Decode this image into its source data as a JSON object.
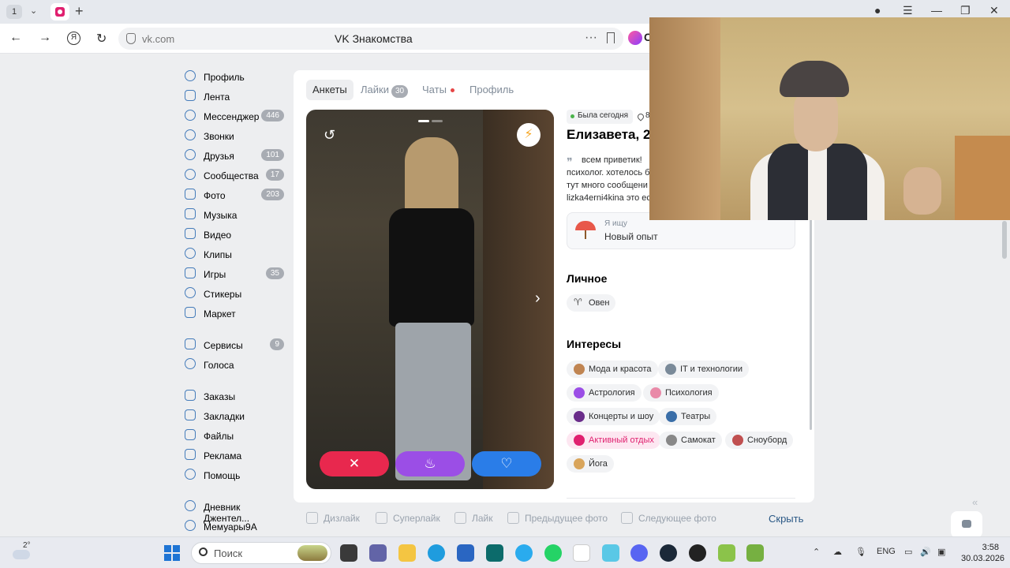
{
  "browser": {
    "tab_count": "1",
    "url": "vk.com",
    "page_title": "VK Знакомства",
    "alice_letter": "С"
  },
  "nav": [
    {
      "label": "Профиль",
      "badge": "",
      "icon": "profile-icon"
    },
    {
      "label": "Лента",
      "badge": "",
      "icon": "feed-icon"
    },
    {
      "label": "Мессенджер",
      "badge": "446",
      "icon": "messenger-icon"
    },
    {
      "label": "Звонки",
      "badge": "",
      "icon": "phone-icon"
    },
    {
      "label": "Друзья",
      "badge": "101",
      "icon": "friends-icon"
    },
    {
      "label": "Сообщества",
      "badge": "17",
      "icon": "communities-icon"
    },
    {
      "label": "Фото",
      "badge": "203",
      "icon": "photo-icon"
    },
    {
      "label": "Музыка",
      "badge": "",
      "icon": "music-icon"
    },
    {
      "label": "Видео",
      "badge": "",
      "icon": "video-icon"
    },
    {
      "label": "Клипы",
      "badge": "",
      "icon": "clips-icon"
    },
    {
      "label": "Игры",
      "badge": "35",
      "icon": "games-icon"
    },
    {
      "label": "Стикеры",
      "badge": "",
      "icon": "stickers-icon"
    },
    {
      "label": "Маркет",
      "badge": "",
      "icon": "market-icon"
    },
    {
      "label": "Сервисы",
      "badge": "9",
      "icon": "services-icon"
    },
    {
      "label": "Голоса",
      "badge": "",
      "icon": "votes-icon"
    },
    {
      "label": "Заказы",
      "badge": "",
      "icon": "orders-icon"
    },
    {
      "label": "Закладки",
      "badge": "",
      "icon": "bookmarks-icon"
    },
    {
      "label": "Файлы",
      "badge": "",
      "icon": "files-icon"
    },
    {
      "label": "Реклама",
      "badge": "",
      "icon": "ads-icon"
    },
    {
      "label": "Помощь",
      "badge": "",
      "icon": "help-icon"
    },
    {
      "label": "Дневник Джентел...",
      "badge": "",
      "icon": "group-icon"
    },
    {
      "label": "Мемуары9А",
      "badge": "",
      "icon": "group-icon"
    }
  ],
  "tabs": {
    "profiles": "Анкеты",
    "likes": "Лайки",
    "likes_count": "30",
    "chats": "Чаты",
    "profile": "Профиль"
  },
  "profile": {
    "status": "Была сегодня",
    "location": "8",
    "name": "Елизавета, 20",
    "bio_lines": [
      "всем приветик!",
      "психолог. хотелось б",
      "тут много сообщени",
      "lizka4erni4kina это ес"
    ],
    "seeking_label": "Я ищу",
    "seeking_value": "Новый опыт",
    "personal_title": "Личное",
    "zodiac": "Овен",
    "interests_title": "Интересы",
    "interests": [
      {
        "label": "Мода и красота",
        "highlight": false,
        "color": "#c08552"
      },
      {
        "label": "IT и технологии",
        "highlight": false,
        "color": "#7a8a99"
      },
      {
        "label": "Астрология",
        "highlight": false,
        "color": "#9b4ee6"
      },
      {
        "label": "Психология",
        "highlight": false,
        "color": "#e98aa8"
      },
      {
        "label": "Концерты и шоу",
        "highlight": false,
        "color": "#6a2d8a"
      },
      {
        "label": "Театры",
        "highlight": false,
        "color": "#3a6ea8"
      },
      {
        "label": "Активный отдых",
        "highlight": true,
        "color": "#e0206f"
      },
      {
        "label": "Самокат",
        "highlight": false,
        "color": "#888888"
      },
      {
        "label": "Сноуборд",
        "highlight": false,
        "color": "#c05050"
      },
      {
        "label": "Йога",
        "highlight": false,
        "color": "#d9a55b"
      }
    ]
  },
  "hints": {
    "dislike": "Дизлайк",
    "superlike": "Суперлайк",
    "like": "Лайк",
    "prev_photo": "Предыдущее фото",
    "next_photo": "Следующее фото",
    "hide": "Скрыть"
  },
  "taskbar": {
    "temperature": "2°",
    "search": "Поиск",
    "lang": "ENG",
    "time": "3:58",
    "date": "30.03.2026"
  },
  "colors": {
    "accent": "#2a5885",
    "dislike": "#e8284e",
    "superlike": "#9b4ee6",
    "like": "#2a7de8"
  }
}
